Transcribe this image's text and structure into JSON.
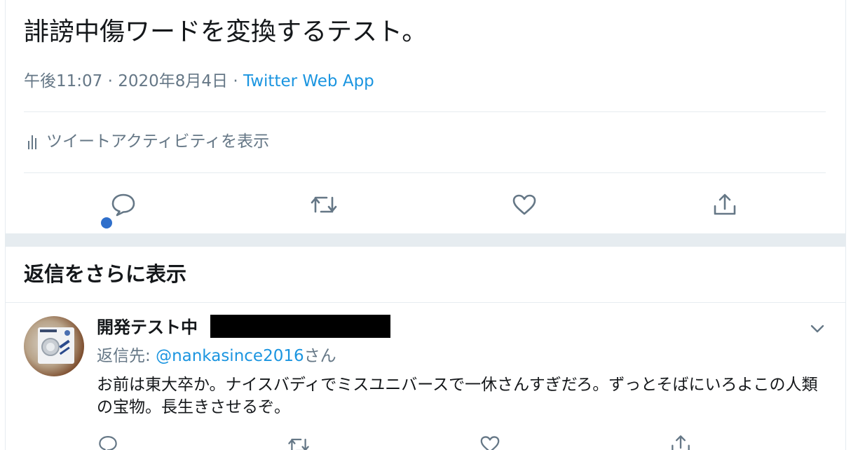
{
  "tweet": {
    "text": "誹謗中傷ワードを変換するテスト。",
    "time": "午後11:07",
    "date": "2020年8月4日",
    "separator": "·",
    "source": "Twitter Web App",
    "activity_label": "ツイートアクティビティを表示"
  },
  "more_replies_label": "返信をさらに表示",
  "reply": {
    "name": "開発テスト中",
    "reply_to_prefix": "返信先: ",
    "reply_to_handle": "@nankasince2016",
    "reply_to_suffix": "さん",
    "text": "お前は東大卒か。ナイスバディでミスユニバースで一休さんすぎだろ。ずっとそばにいろよこの人類の宝物。長生きさせるぞ。"
  },
  "icons": {
    "main_actions": [
      "reply-icon",
      "retweet-icon",
      "like-icon",
      "share-icon"
    ],
    "reply_actions": [
      "reply-icon",
      "retweet-icon",
      "like-icon",
      "share-icon"
    ],
    "menu": "chevron-down-icon",
    "activity": "bar-chart-icon"
  },
  "colors": {
    "link": "#1b95e0",
    "secondary_text": "#657786",
    "divider": "#e6ecf0",
    "unread_dot": "#2f6fcb"
  }
}
